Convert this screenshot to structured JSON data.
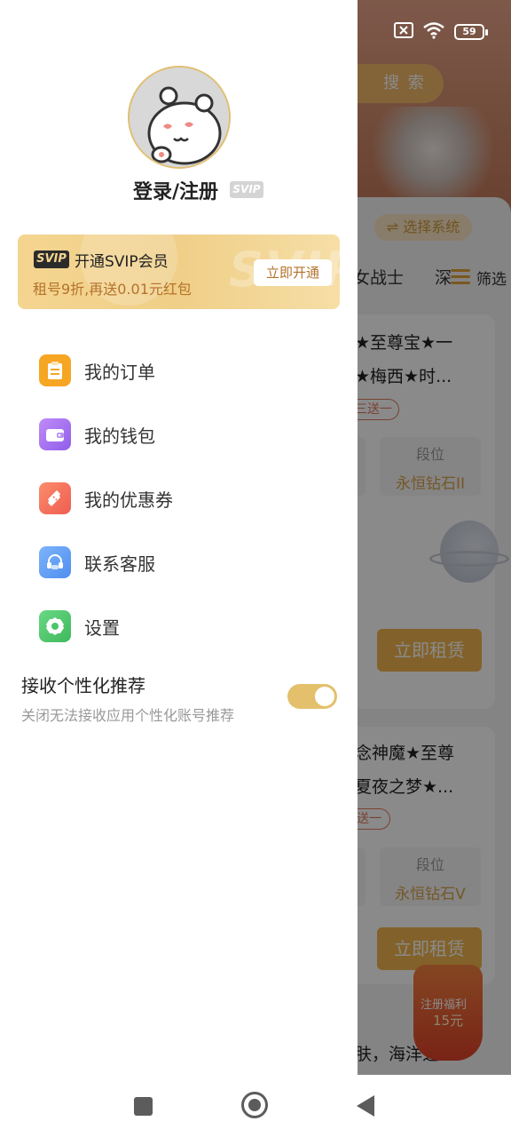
{
  "background": {
    "search_label": "搜 索",
    "select_system": "⇌ 选择系统",
    "tabs": [
      "女战士",
      "深"
    ],
    "filter_label": "筛选",
    "listing1": {
      "title_line1": "★至尊宝★一",
      "title_line2": "★梅西★时...",
      "tag": "三送一",
      "stat_label": "段位",
      "stat_value": "永恒钻石II",
      "rent_button": "立即租赁"
    },
    "listing2": {
      "title_line1": "念神魔★至尊",
      "title_line2": "夏夜之梦★...",
      "tag": "送一",
      "stat_label": "段位",
      "stat_value": "永恒钻石V",
      "rent_button": "立即租赁"
    },
    "reward_banner": {
      "line1": "注册福利",
      "line2": "15元"
    },
    "bottom_snippet": "肤，海洋之"
  },
  "status_bar": {
    "battery": "59"
  },
  "drawer": {
    "login_label": "登录/注册",
    "svip_badge": "SVIP",
    "vip_card": {
      "tag": "SVIP",
      "title": "开通SVIP会员",
      "subtitle": "租号9折,再送0.01元红包",
      "button": "立即开通",
      "decoration_text": "SVIP"
    },
    "menu": [
      {
        "label": "我的订单",
        "icon": "clipboard-icon",
        "color": "#f6a623"
      },
      {
        "label": "我的钱包",
        "icon": "wallet-icon",
        "color": "#a675f0"
      },
      {
        "label": "我的优惠券",
        "icon": "coupon-icon",
        "color": "#f4705a"
      },
      {
        "label": "联系客服",
        "icon": "headset-icon",
        "color": "#5b9df5"
      },
      {
        "label": "设置",
        "icon": "gear-icon",
        "color": "#4cc66a"
      }
    ],
    "personalization": {
      "title": "接收个性化推荐",
      "subtitle": "关闭无法接收应用个性化账号推荐",
      "enabled": true
    }
  }
}
